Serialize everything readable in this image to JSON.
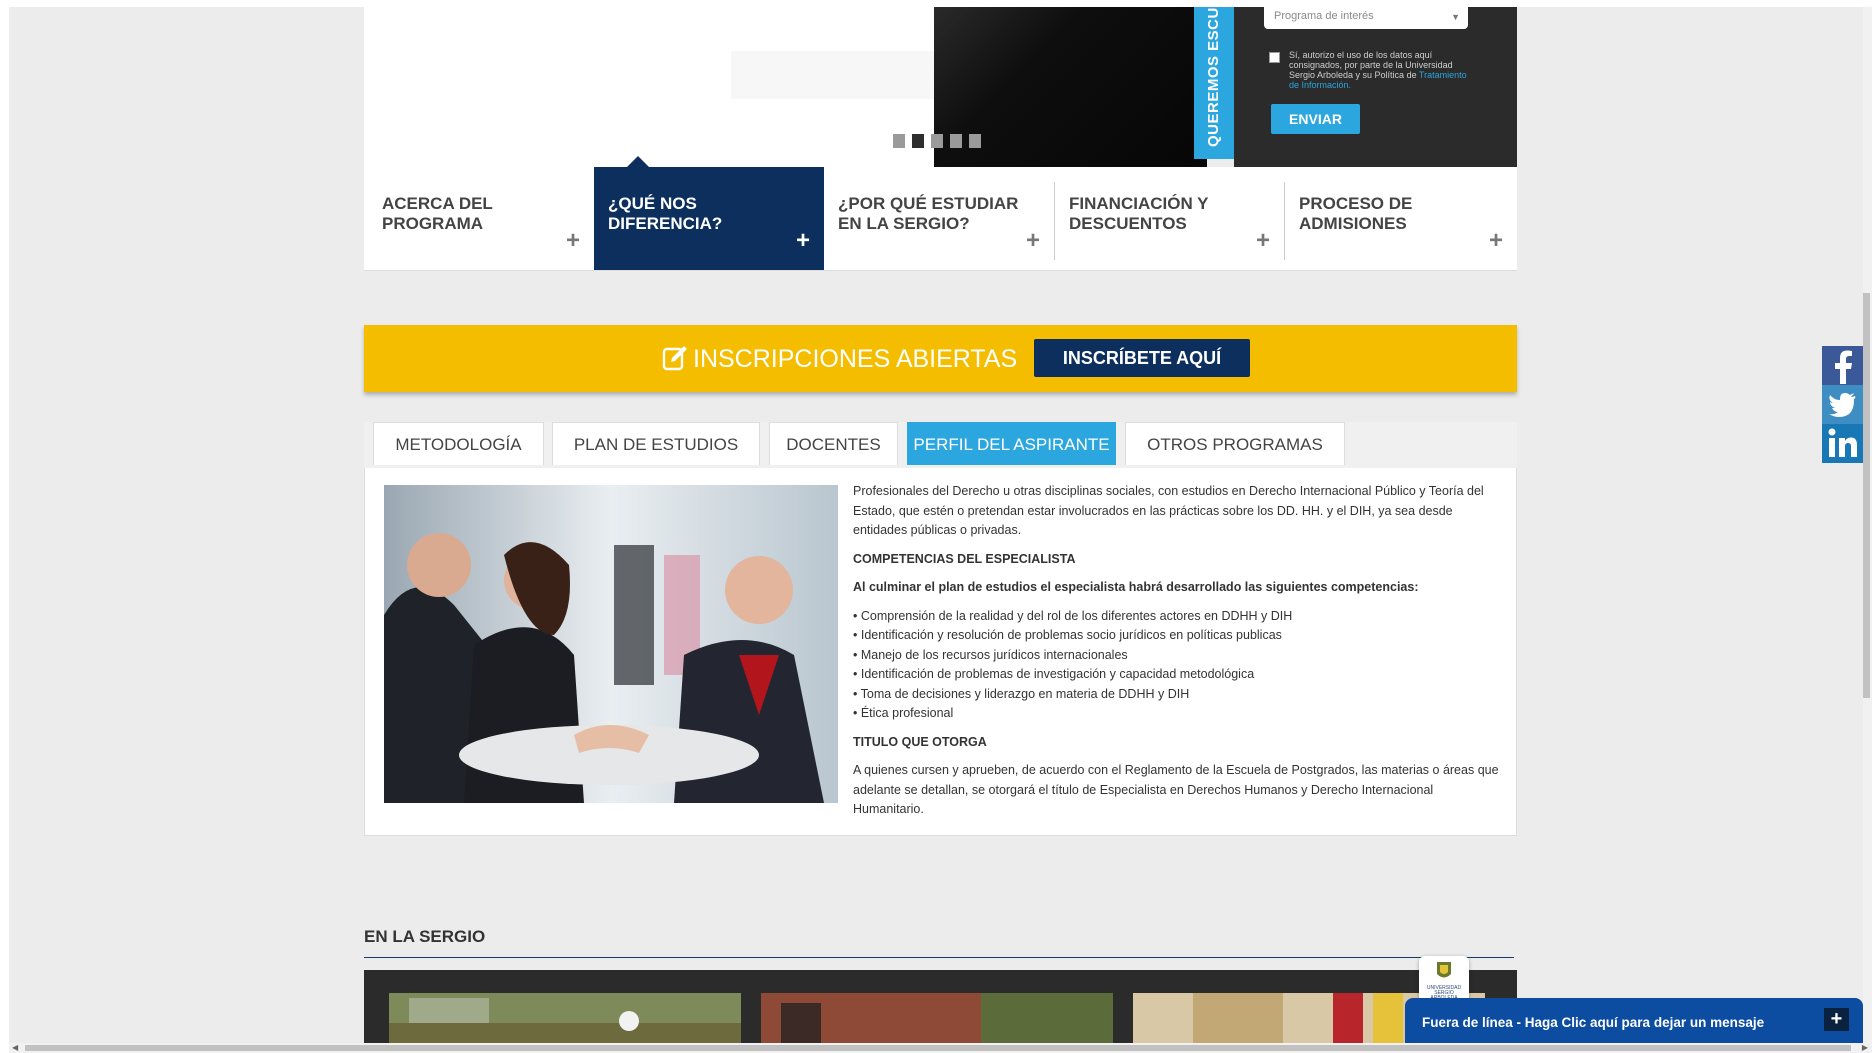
{
  "hero": {
    "program_select_placeholder": "Programa de interés",
    "side_tab_label": "QUEREMOS ESCUCHARTE",
    "consent_text": "Sí, autorizo el uso de los datos aquí consignados, por parte de la Universidad Sergio Arboleda y su Política de",
    "consent_link": "Tratamiento de Información.",
    "send_label": "ENVIAR",
    "slider_dots": 5,
    "active_dot": 1
  },
  "accordion": [
    {
      "label": "ACERCA DEL PROGRAMA",
      "plus": "+"
    },
    {
      "label": "¿QUÉ NOS DIFERENCIA?",
      "plus": "+"
    },
    {
      "label": "¿POR QUÉ ESTUDIAR EN LA SERGIO?",
      "plus": "+"
    },
    {
      "label": "FINANCIACIÓN Y DESCUENTOS",
      "plus": "+"
    },
    {
      "label": "PROCESO DE ADMISIONES",
      "plus": "+"
    }
  ],
  "banner": {
    "text": "INSCRIPCIONES ABIERTAS",
    "button": "INSCRÍBETE AQUÍ"
  },
  "tabs": [
    {
      "label": "METODOLOGÍA"
    },
    {
      "label": "PLAN DE ESTUDIOS"
    },
    {
      "label": "DOCENTES"
    },
    {
      "label": "PERFIL DEL ASPIRANTE"
    },
    {
      "label": "OTROS PROGRAMAS"
    }
  ],
  "content": {
    "intro": "Profesionales del Derecho u otras disciplinas sociales, con estudios en Derecho Internacional Público y Teoría del Estado, que estén o pretendan estar involucrados en las prácticas sobre los DD. HH. y el DIH, ya sea desde entidades públicas o privadas.",
    "competencias_heading": "COMPETENCIAS DEL ESPECIALISTA",
    "competencias_lead": "Al culminar el plan de estudios el especialista habrá desarrollado las siguientes competencias:",
    "competencias": [
      "• Comprensión de la realidad y del rol de los diferentes actores en DDHH y DIH",
      "• Identificación y resolución de problemas socio jurídicos en políticas publicas",
      "• Manejo de los recursos jurídicos internacionales",
      "• Identificación de problemas de investigación y capacidad metodológica",
      "• Toma de decisiones y liderazgo en materia de DDHH y DIH",
      "• Ética profesional"
    ],
    "titulo_heading": "TITULO QUE OTORGA",
    "titulo_text": "A quienes cursen y aprueben, de acuerdo con el Reglamento de la Escuela de Postgrados, las materias o áreas que adelante se detallan, se otorgará el título de Especialista en Derechos Humanos y Derecho Internacional Humanitario."
  },
  "sergio": {
    "heading": "EN LA SERGIO"
  },
  "social": [
    "facebook-icon",
    "twitter-icon",
    "linkedin-icon"
  ],
  "chat": {
    "logo_caption": "UNIVERSIDAD SERGIO ARBOLEDA",
    "text": "Fuera de línea - Haga Clic aquí para dejar un mensaje",
    "plus": "+"
  },
  "colors": {
    "navy": "#0c2f5e",
    "accent_blue": "#2ba6de",
    "banner_yellow": "#f5bd00",
    "chat_blue": "#0c4da2"
  }
}
